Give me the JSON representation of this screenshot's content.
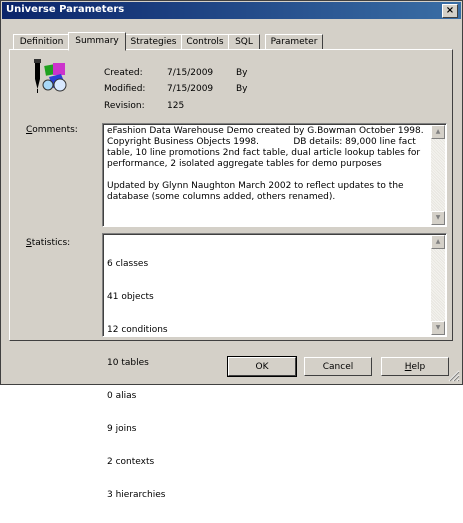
{
  "window": {
    "title": "Universe Parameters",
    "close": "×"
  },
  "tabs": [
    "Definition",
    "Summary",
    "Strategies",
    "Controls",
    "SQL",
    "Parameter"
  ],
  "summary": {
    "created_label": "Created:",
    "created_date": "7/15/2009",
    "created_by": "By",
    "modified_label": "Modified:",
    "modified_date": "7/15/2009",
    "modified_by": "By",
    "revision_label": "Revision:",
    "revision_value": "125",
    "comments_label_pre": "",
    "comments_label_u": "C",
    "comments_label_post": "omments:",
    "comments_text": "eFashion Data Warehouse Demo created by G.Bowman October 1998.\nCopyright Business Objects 1998.            DB details: 89,000 line fact\ntable, 10 line promotions 2nd fact table, dual article lookup tables for\nperformance, 2 isolated aggregate tables for demo purposes\n\nUpdated by Glynn Naughton March 2002 to reflect updates to the\ndatabase (some columns added, others renamed).",
    "statistics_label_pre": "",
    "statistics_label_u": "S",
    "statistics_label_post": "tatistics:",
    "statistics": [
      "6 classes",
      "41 objects",
      "12 conditions",
      "10 tables",
      "0 alias",
      "9 joins",
      "2 contexts",
      "3 hierarchies"
    ]
  },
  "buttons": {
    "ok": "OK",
    "cancel": "Cancel",
    "help_u": "H",
    "help_rest": "elp"
  },
  "icon": "universe-icon"
}
